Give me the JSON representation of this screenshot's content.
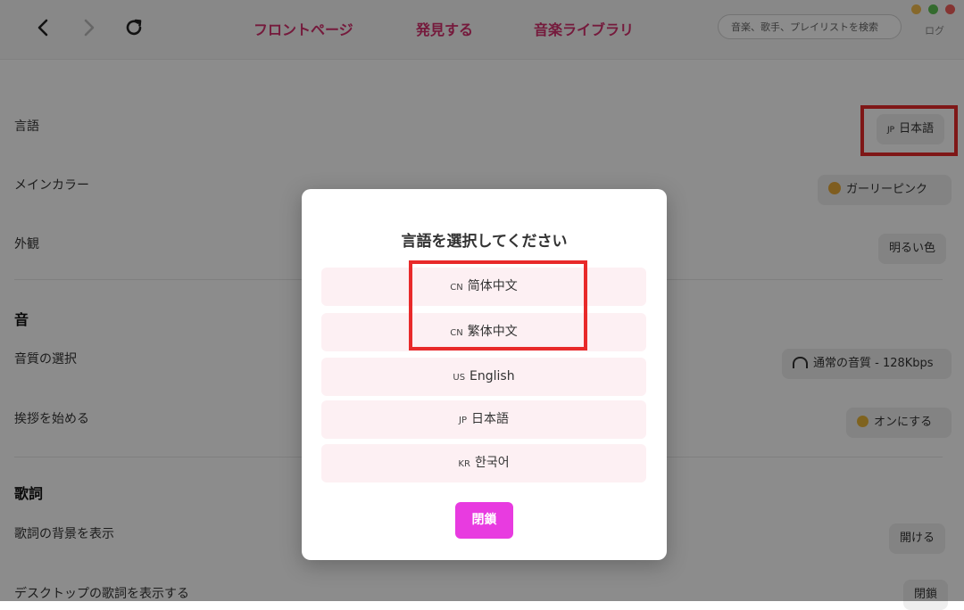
{
  "window": {
    "controls": [
      {
        "name": "minimize",
        "color": "#f5be4f"
      },
      {
        "name": "maximize",
        "color": "#5fc454"
      },
      {
        "name": "close",
        "color": "#f2605b"
      }
    ]
  },
  "nav": {
    "back_icon": "chevron-left-icon",
    "forward_icon": "chevron-right-icon",
    "reload_icon": "reload-icon",
    "links": [
      "フロントページ",
      "発見する",
      "音楽ライブラリ"
    ],
    "search_placeholder": "音楽、歌手、プレイリストを検索",
    "user_label": "ログ"
  },
  "settings": {
    "language": {
      "label": "言語",
      "flag": "JP",
      "value": "日本語"
    },
    "main_color": {
      "label": "メインカラー",
      "value": "ガーリーピンク",
      "icon": "palette-icon"
    },
    "appearance": {
      "label": "外観",
      "value": "明るい色"
    },
    "sound_section": "音",
    "quality": {
      "label": "音質の選択",
      "value": "通常の音質 - 128Kbps",
      "icon": "headphones-icon"
    },
    "greeting": {
      "label": "挨拶を始める",
      "value": "オンにする",
      "icon": "wave-icon"
    },
    "lyrics_section": "歌詞",
    "lyrics_bg": {
      "label": "歌詞の背景を表示",
      "value": "開ける"
    },
    "desktop_lyrics": {
      "label": "デスクトップの歌詞を表示する",
      "value": "閉鎖"
    }
  },
  "modal": {
    "title": "言語を選択してください",
    "options": [
      {
        "code": "CN",
        "label": "简体中文"
      },
      {
        "code": "CN",
        "label": "繁体中文"
      },
      {
        "code": "US",
        "label": "English"
      },
      {
        "code": "JP",
        "label": "日本語"
      },
      {
        "code": "KR",
        "label": "한국어"
      }
    ],
    "close_label": "閉鎖"
  },
  "colors": {
    "accent": "#d6306e",
    "close_button": "#e83be0",
    "option_bg": "#fdf0f3",
    "annotation": "#e82a2a"
  }
}
